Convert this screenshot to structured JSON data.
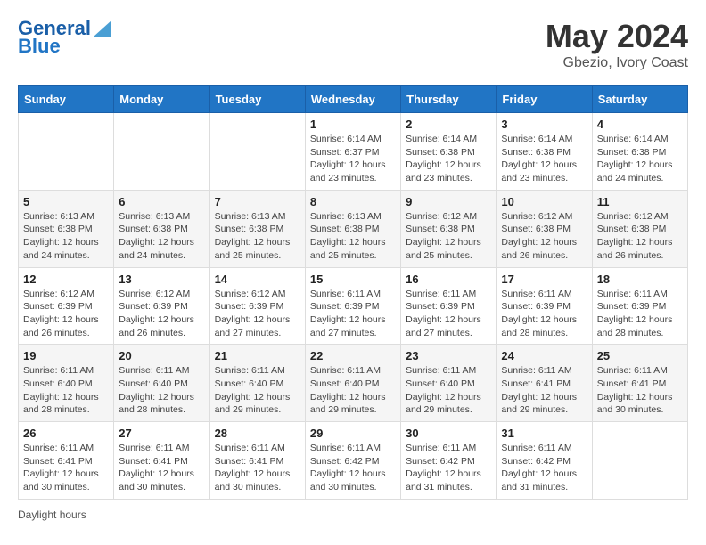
{
  "header": {
    "logo_line1": "General",
    "logo_line2": "Blue",
    "main_title": "May 2024",
    "subtitle": "Gbezio, Ivory Coast"
  },
  "days_of_week": [
    "Sunday",
    "Monday",
    "Tuesday",
    "Wednesday",
    "Thursday",
    "Friday",
    "Saturday"
  ],
  "footer_label": "Daylight hours",
  "weeks": [
    [
      {
        "day": "",
        "info": ""
      },
      {
        "day": "",
        "info": ""
      },
      {
        "day": "",
        "info": ""
      },
      {
        "day": "1",
        "info": "Sunrise: 6:14 AM\nSunset: 6:37 PM\nDaylight: 12 hours and 23 minutes."
      },
      {
        "day": "2",
        "info": "Sunrise: 6:14 AM\nSunset: 6:38 PM\nDaylight: 12 hours and 23 minutes."
      },
      {
        "day": "3",
        "info": "Sunrise: 6:14 AM\nSunset: 6:38 PM\nDaylight: 12 hours and 23 minutes."
      },
      {
        "day": "4",
        "info": "Sunrise: 6:14 AM\nSunset: 6:38 PM\nDaylight: 12 hours and 24 minutes."
      }
    ],
    [
      {
        "day": "5",
        "info": "Sunrise: 6:13 AM\nSunset: 6:38 PM\nDaylight: 12 hours and 24 minutes."
      },
      {
        "day": "6",
        "info": "Sunrise: 6:13 AM\nSunset: 6:38 PM\nDaylight: 12 hours and 24 minutes."
      },
      {
        "day": "7",
        "info": "Sunrise: 6:13 AM\nSunset: 6:38 PM\nDaylight: 12 hours and 25 minutes."
      },
      {
        "day": "8",
        "info": "Sunrise: 6:13 AM\nSunset: 6:38 PM\nDaylight: 12 hours and 25 minutes."
      },
      {
        "day": "9",
        "info": "Sunrise: 6:12 AM\nSunset: 6:38 PM\nDaylight: 12 hours and 25 minutes."
      },
      {
        "day": "10",
        "info": "Sunrise: 6:12 AM\nSunset: 6:38 PM\nDaylight: 12 hours and 26 minutes."
      },
      {
        "day": "11",
        "info": "Sunrise: 6:12 AM\nSunset: 6:38 PM\nDaylight: 12 hours and 26 minutes."
      }
    ],
    [
      {
        "day": "12",
        "info": "Sunrise: 6:12 AM\nSunset: 6:39 PM\nDaylight: 12 hours and 26 minutes."
      },
      {
        "day": "13",
        "info": "Sunrise: 6:12 AM\nSunset: 6:39 PM\nDaylight: 12 hours and 26 minutes."
      },
      {
        "day": "14",
        "info": "Sunrise: 6:12 AM\nSunset: 6:39 PM\nDaylight: 12 hours and 27 minutes."
      },
      {
        "day": "15",
        "info": "Sunrise: 6:11 AM\nSunset: 6:39 PM\nDaylight: 12 hours and 27 minutes."
      },
      {
        "day": "16",
        "info": "Sunrise: 6:11 AM\nSunset: 6:39 PM\nDaylight: 12 hours and 27 minutes."
      },
      {
        "day": "17",
        "info": "Sunrise: 6:11 AM\nSunset: 6:39 PM\nDaylight: 12 hours and 28 minutes."
      },
      {
        "day": "18",
        "info": "Sunrise: 6:11 AM\nSunset: 6:39 PM\nDaylight: 12 hours and 28 minutes."
      }
    ],
    [
      {
        "day": "19",
        "info": "Sunrise: 6:11 AM\nSunset: 6:40 PM\nDaylight: 12 hours and 28 minutes."
      },
      {
        "day": "20",
        "info": "Sunrise: 6:11 AM\nSunset: 6:40 PM\nDaylight: 12 hours and 28 minutes."
      },
      {
        "day": "21",
        "info": "Sunrise: 6:11 AM\nSunset: 6:40 PM\nDaylight: 12 hours and 29 minutes."
      },
      {
        "day": "22",
        "info": "Sunrise: 6:11 AM\nSunset: 6:40 PM\nDaylight: 12 hours and 29 minutes."
      },
      {
        "day": "23",
        "info": "Sunrise: 6:11 AM\nSunset: 6:40 PM\nDaylight: 12 hours and 29 minutes."
      },
      {
        "day": "24",
        "info": "Sunrise: 6:11 AM\nSunset: 6:41 PM\nDaylight: 12 hours and 29 minutes."
      },
      {
        "day": "25",
        "info": "Sunrise: 6:11 AM\nSunset: 6:41 PM\nDaylight: 12 hours and 30 minutes."
      }
    ],
    [
      {
        "day": "26",
        "info": "Sunrise: 6:11 AM\nSunset: 6:41 PM\nDaylight: 12 hours and 30 minutes."
      },
      {
        "day": "27",
        "info": "Sunrise: 6:11 AM\nSunset: 6:41 PM\nDaylight: 12 hours and 30 minutes."
      },
      {
        "day": "28",
        "info": "Sunrise: 6:11 AM\nSunset: 6:41 PM\nDaylight: 12 hours and 30 minutes."
      },
      {
        "day": "29",
        "info": "Sunrise: 6:11 AM\nSunset: 6:42 PM\nDaylight: 12 hours and 30 minutes."
      },
      {
        "day": "30",
        "info": "Sunrise: 6:11 AM\nSunset: 6:42 PM\nDaylight: 12 hours and 31 minutes."
      },
      {
        "day": "31",
        "info": "Sunrise: 6:11 AM\nSunset: 6:42 PM\nDaylight: 12 hours and 31 minutes."
      },
      {
        "day": "",
        "info": ""
      }
    ]
  ]
}
